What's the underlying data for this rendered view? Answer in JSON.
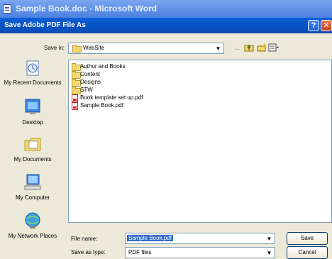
{
  "window": {
    "title": "Sample Book.doc - Microsoft Word"
  },
  "dialog": {
    "title": "Save Adobe PDF File As",
    "help_symbol": "?",
    "close_symbol": "✕"
  },
  "save_in": {
    "label": "Save in:",
    "value": "WebSite"
  },
  "places": [
    {
      "label": "My Recent Documents",
      "icon": "recent-documents-icon"
    },
    {
      "label": "Desktop",
      "icon": "desktop-icon"
    },
    {
      "label": "My Documents",
      "icon": "my-documents-icon"
    },
    {
      "label": "My Computer",
      "icon": "my-computer-icon"
    },
    {
      "label": "My Network Places",
      "icon": "network-places-icon"
    }
  ],
  "files": [
    {
      "name": "Author and Books",
      "type": "folder"
    },
    {
      "name": "Content",
      "type": "folder"
    },
    {
      "name": "Designs",
      "type": "folder"
    },
    {
      "name": "STW",
      "type": "folder"
    },
    {
      "name": "Book template set up.pdf",
      "type": "pdf"
    },
    {
      "name": "Sample Book.pdf",
      "type": "pdf"
    }
  ],
  "file_name": {
    "label": "File name:",
    "value": "Sample Book.pdf"
  },
  "save_as_type": {
    "label": "Save as type:",
    "value": "PDF files"
  },
  "buttons": {
    "save": "Save",
    "cancel": "Cancel"
  }
}
